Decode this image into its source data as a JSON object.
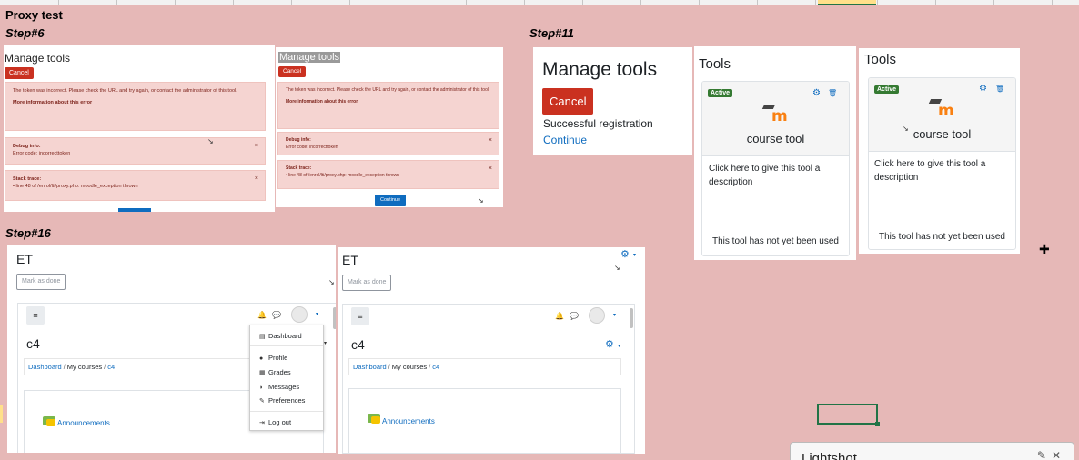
{
  "sheet": {
    "title": "Proxy test"
  },
  "steps": {
    "s6": "Step#6",
    "s11": "Step#11",
    "s16": "Step#16"
  },
  "step6": {
    "title": "Manage tools",
    "cancel": "Cancel",
    "error_msg": "The token was incorrect. Please check the URL and try again, or contact the administrator of this tool.",
    "more_info": "More information about this error",
    "debug_heading": "Debug info:",
    "debug_text": "Error code: incorrecttoken",
    "stack_heading": "Stack trace:",
    "stack_text": "• line 48 of /enrol/lti/proxy.php: moodle_exception thrown",
    "continue": "Continue",
    "close_glyph": "×"
  },
  "step11": {
    "title": "Manage tools",
    "cancel": "Cancel",
    "success": "Successful registration",
    "continue": "Continue",
    "tools_title": "Tools",
    "badge": "Active",
    "tool_name": "course tool",
    "description": "Click here to give this tool a description",
    "not_used": "This tool has not yet been used",
    "logo_text": "m"
  },
  "step16": {
    "et_title": "ET",
    "mark_done": "Mark as done",
    "course": "c4",
    "breadcrumb": {
      "dashboard": "Dashboard",
      "sep": "/",
      "my_courses": "My courses",
      "course": "c4"
    },
    "announcements": "Announcements",
    "menu": {
      "dashboard": "Dashboard",
      "profile": "Profile",
      "grades": "Grades",
      "messages": "Messages",
      "preferences": "Preferences",
      "logout": "Log out"
    }
  },
  "lightshot": {
    "title": "Lightshot"
  },
  "icons": {
    "gear": "⚙",
    "trash": "🗑",
    "bell": "🔔",
    "chat": "💬",
    "hamburger": "≡",
    "caret": "▾",
    "move": "✚"
  },
  "colors": {
    "background": "#e6b8b7",
    "danger": "#ca3120",
    "primary": "#0f6cbf",
    "success": "#357a32"
  }
}
